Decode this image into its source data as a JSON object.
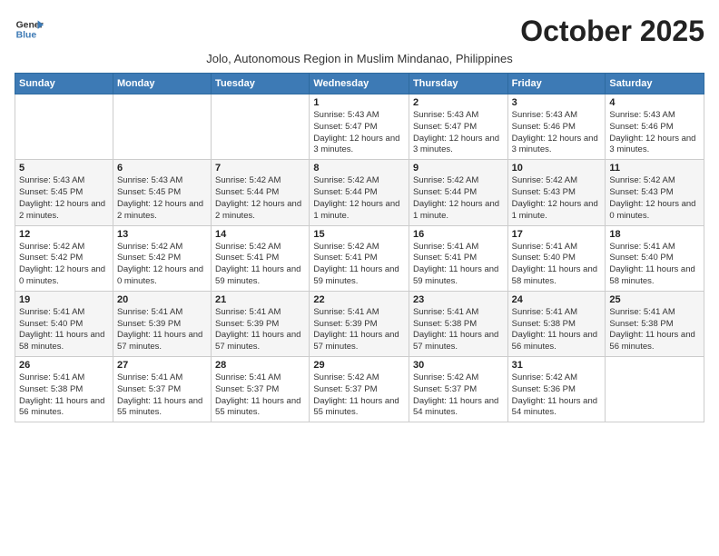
{
  "logo": {
    "line1": "General",
    "line2": "Blue"
  },
  "title": "October 2025",
  "subtitle": "Jolo, Autonomous Region in Muslim Mindanao, Philippines",
  "days_header": [
    "Sunday",
    "Monday",
    "Tuesday",
    "Wednesday",
    "Thursday",
    "Friday",
    "Saturday"
  ],
  "weeks": [
    [
      {
        "num": "",
        "info": ""
      },
      {
        "num": "",
        "info": ""
      },
      {
        "num": "",
        "info": ""
      },
      {
        "num": "1",
        "info": "Sunrise: 5:43 AM\nSunset: 5:47 PM\nDaylight: 12 hours and 3 minutes."
      },
      {
        "num": "2",
        "info": "Sunrise: 5:43 AM\nSunset: 5:47 PM\nDaylight: 12 hours and 3 minutes."
      },
      {
        "num": "3",
        "info": "Sunrise: 5:43 AM\nSunset: 5:46 PM\nDaylight: 12 hours and 3 minutes."
      },
      {
        "num": "4",
        "info": "Sunrise: 5:43 AM\nSunset: 5:46 PM\nDaylight: 12 hours and 3 minutes."
      }
    ],
    [
      {
        "num": "5",
        "info": "Sunrise: 5:43 AM\nSunset: 5:45 PM\nDaylight: 12 hours and 2 minutes."
      },
      {
        "num": "6",
        "info": "Sunrise: 5:43 AM\nSunset: 5:45 PM\nDaylight: 12 hours and 2 minutes."
      },
      {
        "num": "7",
        "info": "Sunrise: 5:42 AM\nSunset: 5:44 PM\nDaylight: 12 hours and 2 minutes."
      },
      {
        "num": "8",
        "info": "Sunrise: 5:42 AM\nSunset: 5:44 PM\nDaylight: 12 hours and 1 minute."
      },
      {
        "num": "9",
        "info": "Sunrise: 5:42 AM\nSunset: 5:44 PM\nDaylight: 12 hours and 1 minute."
      },
      {
        "num": "10",
        "info": "Sunrise: 5:42 AM\nSunset: 5:43 PM\nDaylight: 12 hours and 1 minute."
      },
      {
        "num": "11",
        "info": "Sunrise: 5:42 AM\nSunset: 5:43 PM\nDaylight: 12 hours and 0 minutes."
      }
    ],
    [
      {
        "num": "12",
        "info": "Sunrise: 5:42 AM\nSunset: 5:42 PM\nDaylight: 12 hours and 0 minutes."
      },
      {
        "num": "13",
        "info": "Sunrise: 5:42 AM\nSunset: 5:42 PM\nDaylight: 12 hours and 0 minutes."
      },
      {
        "num": "14",
        "info": "Sunrise: 5:42 AM\nSunset: 5:41 PM\nDaylight: 11 hours and 59 minutes."
      },
      {
        "num": "15",
        "info": "Sunrise: 5:42 AM\nSunset: 5:41 PM\nDaylight: 11 hours and 59 minutes."
      },
      {
        "num": "16",
        "info": "Sunrise: 5:41 AM\nSunset: 5:41 PM\nDaylight: 11 hours and 59 minutes."
      },
      {
        "num": "17",
        "info": "Sunrise: 5:41 AM\nSunset: 5:40 PM\nDaylight: 11 hours and 58 minutes."
      },
      {
        "num": "18",
        "info": "Sunrise: 5:41 AM\nSunset: 5:40 PM\nDaylight: 11 hours and 58 minutes."
      }
    ],
    [
      {
        "num": "19",
        "info": "Sunrise: 5:41 AM\nSunset: 5:40 PM\nDaylight: 11 hours and 58 minutes."
      },
      {
        "num": "20",
        "info": "Sunrise: 5:41 AM\nSunset: 5:39 PM\nDaylight: 11 hours and 57 minutes."
      },
      {
        "num": "21",
        "info": "Sunrise: 5:41 AM\nSunset: 5:39 PM\nDaylight: 11 hours and 57 minutes."
      },
      {
        "num": "22",
        "info": "Sunrise: 5:41 AM\nSunset: 5:39 PM\nDaylight: 11 hours and 57 minutes."
      },
      {
        "num": "23",
        "info": "Sunrise: 5:41 AM\nSunset: 5:38 PM\nDaylight: 11 hours and 57 minutes."
      },
      {
        "num": "24",
        "info": "Sunrise: 5:41 AM\nSunset: 5:38 PM\nDaylight: 11 hours and 56 minutes."
      },
      {
        "num": "25",
        "info": "Sunrise: 5:41 AM\nSunset: 5:38 PM\nDaylight: 11 hours and 56 minutes."
      }
    ],
    [
      {
        "num": "26",
        "info": "Sunrise: 5:41 AM\nSunset: 5:38 PM\nDaylight: 11 hours and 56 minutes."
      },
      {
        "num": "27",
        "info": "Sunrise: 5:41 AM\nSunset: 5:37 PM\nDaylight: 11 hours and 55 minutes."
      },
      {
        "num": "28",
        "info": "Sunrise: 5:41 AM\nSunset: 5:37 PM\nDaylight: 11 hours and 55 minutes."
      },
      {
        "num": "29",
        "info": "Sunrise: 5:42 AM\nSunset: 5:37 PM\nDaylight: 11 hours and 55 minutes."
      },
      {
        "num": "30",
        "info": "Sunrise: 5:42 AM\nSunset: 5:37 PM\nDaylight: 11 hours and 54 minutes."
      },
      {
        "num": "31",
        "info": "Sunrise: 5:42 AM\nSunset: 5:36 PM\nDaylight: 11 hours and 54 minutes."
      },
      {
        "num": "",
        "info": ""
      }
    ]
  ]
}
